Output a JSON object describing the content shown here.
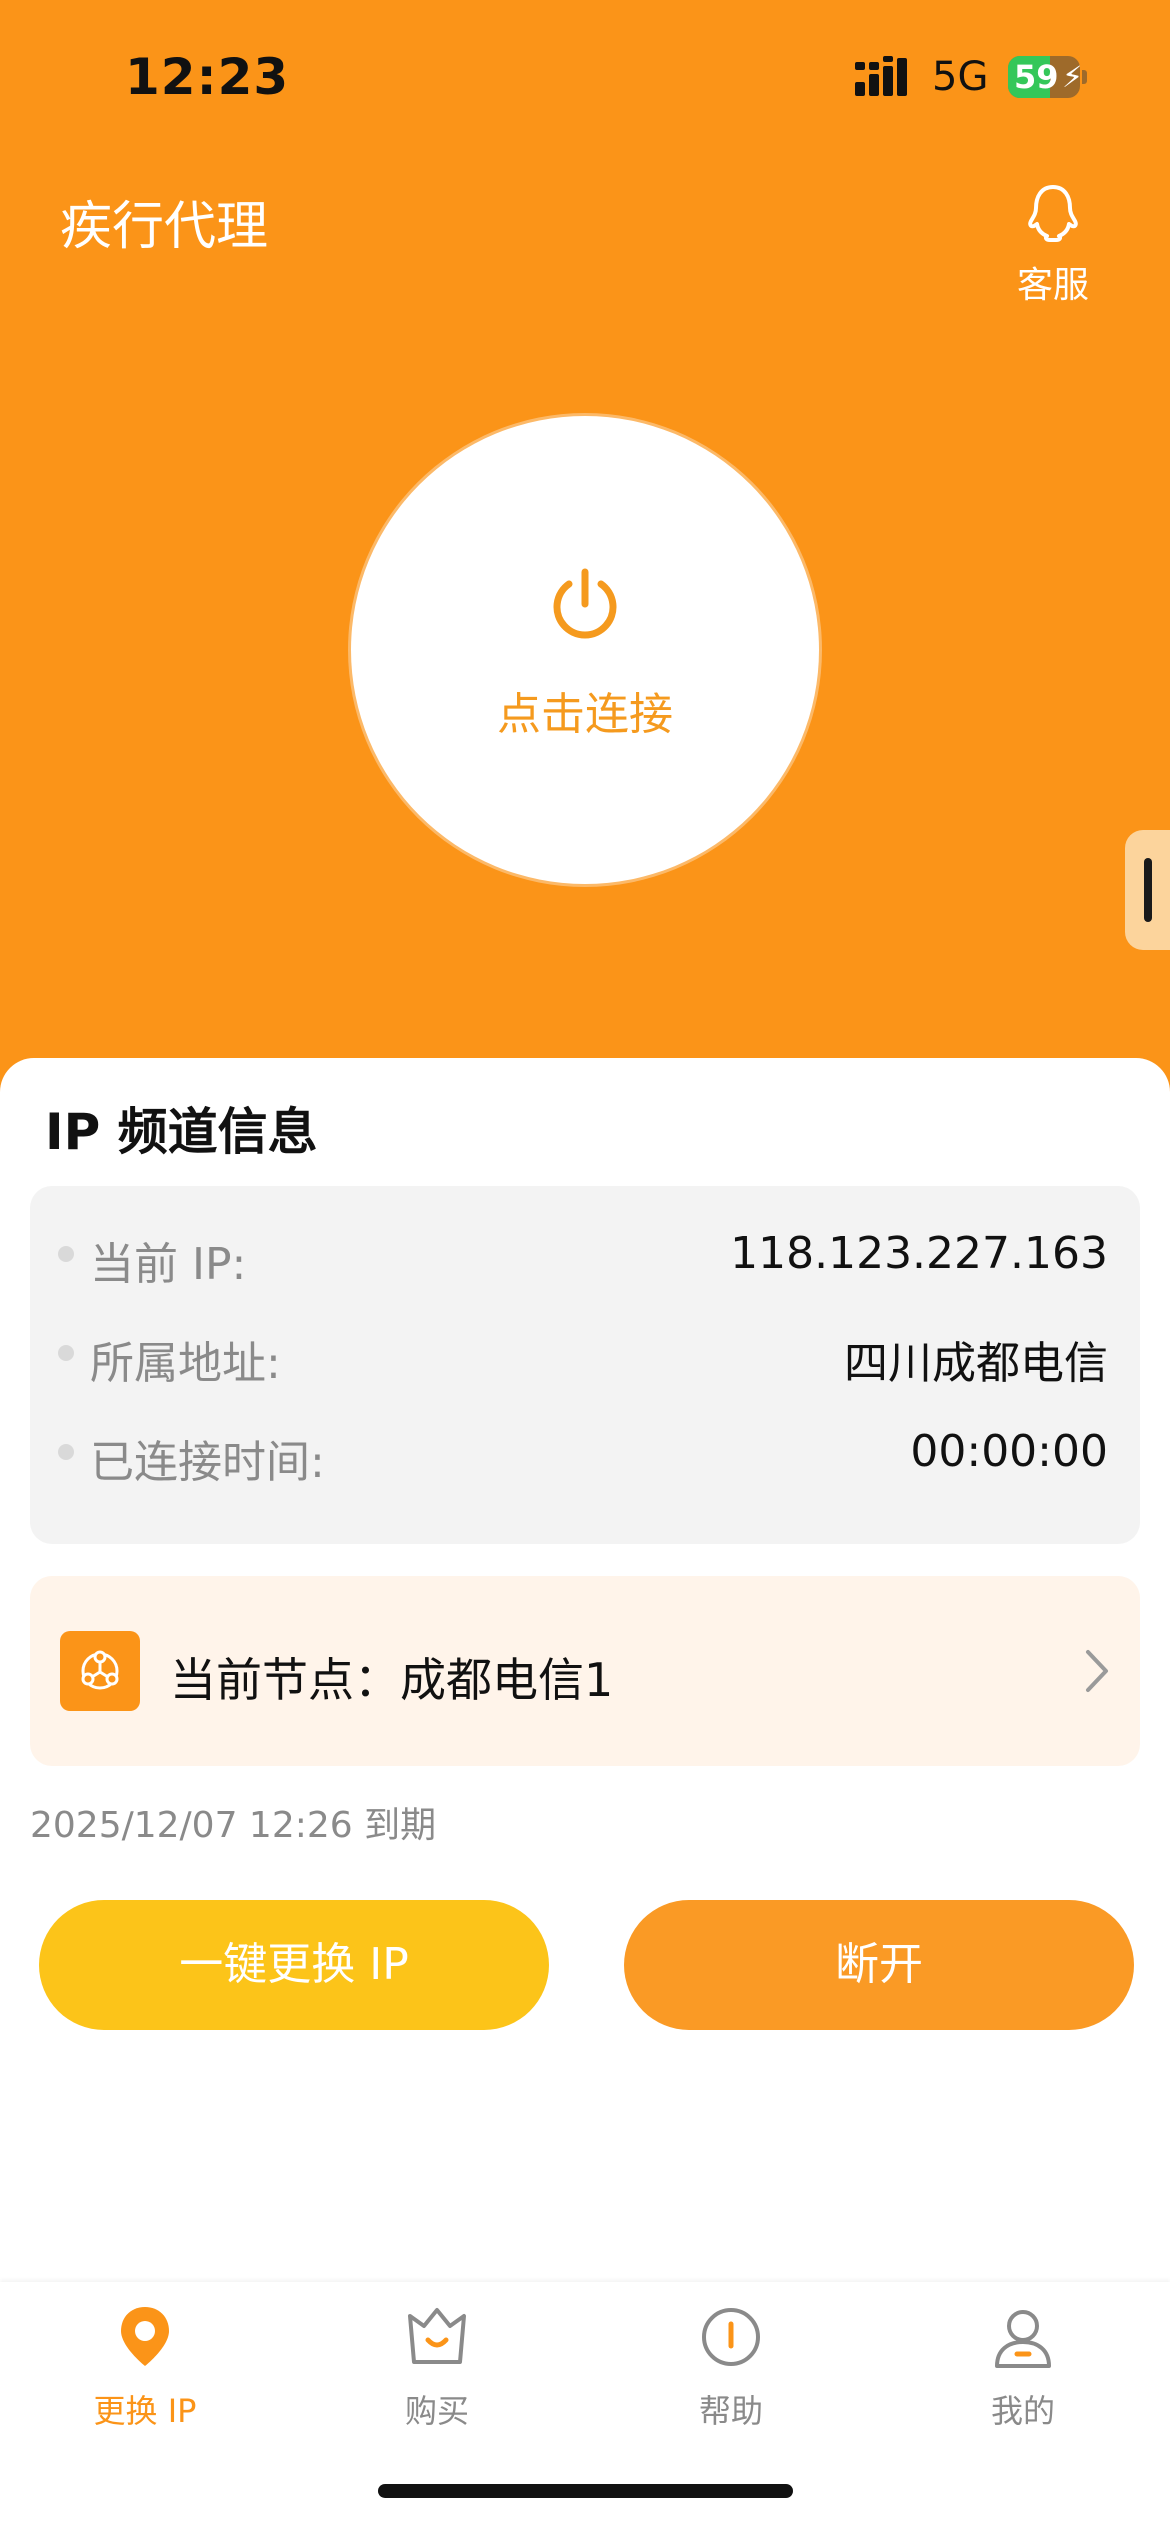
{
  "status_bar": {
    "time": "12:23",
    "network": "5G",
    "battery_percent": 59,
    "battery_label": "59"
  },
  "header": {
    "title": "疾行代理",
    "support_label": "客服",
    "support_icon": "qq-penguin-icon"
  },
  "connect": {
    "label": "点击连接",
    "icon": "power-icon"
  },
  "ip_info": {
    "title": "IP 频道信息",
    "rows": [
      {
        "label": "当前 IP:",
        "value": "118.123.227.163"
      },
      {
        "label": "所属地址:",
        "value": "四川成都电信"
      },
      {
        "label": "已连接时间:",
        "value": "00:00:00"
      }
    ]
  },
  "node": {
    "label": "当前节点：成都电信1",
    "icon": "node-network-icon",
    "chevron_icon": "chevron-right-icon"
  },
  "expiry": "2025/12/07 12:26 到期",
  "actions": {
    "change_ip": "一键更换 IP",
    "disconnect": "断开"
  },
  "tabs": [
    {
      "label": "更换 IP",
      "icon": "location-pin-icon",
      "active": true
    },
    {
      "label": "购买",
      "icon": "shop-basket-icon",
      "active": false
    },
    {
      "label": "帮助",
      "icon": "info-icon",
      "active": false
    },
    {
      "label": "我的",
      "icon": "user-icon",
      "active": false
    }
  ],
  "colors": {
    "brand_orange": "#fb9418",
    "button_yellow": "#fcc419",
    "button_orange": "#fa9a25",
    "node_card_bg": "#fff4ea",
    "battery_green": "#34c759"
  }
}
